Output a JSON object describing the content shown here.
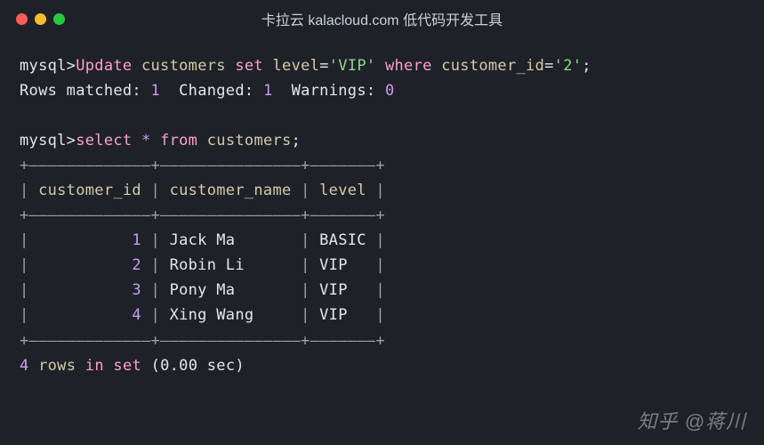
{
  "titlebar": {
    "title": "卡拉云 kalacloud.com 低代码开发工具"
  },
  "lines": {
    "prompt1": "mysql>",
    "kw_update": "Update",
    "ident_customers": "customers",
    "kw_set": "set",
    "ident_level": "level",
    "eq": "=",
    "str_vip": "'VIP'",
    "kw_where": "where",
    "ident_customer_id": "customer_id",
    "str_2": "'2'",
    "semicolon": ";",
    "rows_matched_label": "Rows matched:",
    "rows_matched_val": "1",
    "changed_label": "Changed:",
    "changed_val": "1",
    "warnings_label": "Warnings:",
    "warnings_val": "0",
    "prompt2": "mysql>",
    "kw_select": "select",
    "star": "*",
    "kw_from": "from",
    "ident_customers2": "customers",
    "semicolon2": ";",
    "border_top": "+—————————————+———————————————+———————+",
    "border_mid": "+—————————————+———————————————+———————+",
    "border_bottom": "+—————————————+———————————————+———————+",
    "header": {
      "col1": "customer_id",
      "col2": "customer_name",
      "col3": "level"
    },
    "rows": [
      {
        "id": "1",
        "name": "Jack Ma",
        "level": "BASIC"
      },
      {
        "id": "2",
        "name": "Robin Li",
        "level": "VIP"
      },
      {
        "id": "3",
        "name": "Pony Ma",
        "level": "VIP"
      },
      {
        "id": "4",
        "name": "Xing Wang",
        "level": "VIP"
      }
    ],
    "footer_count": "4",
    "footer_rows": "rows",
    "footer_in": "in",
    "footer_set": "set",
    "footer_time": "(0.00 sec)"
  },
  "watermark": "知乎 @蒋川"
}
